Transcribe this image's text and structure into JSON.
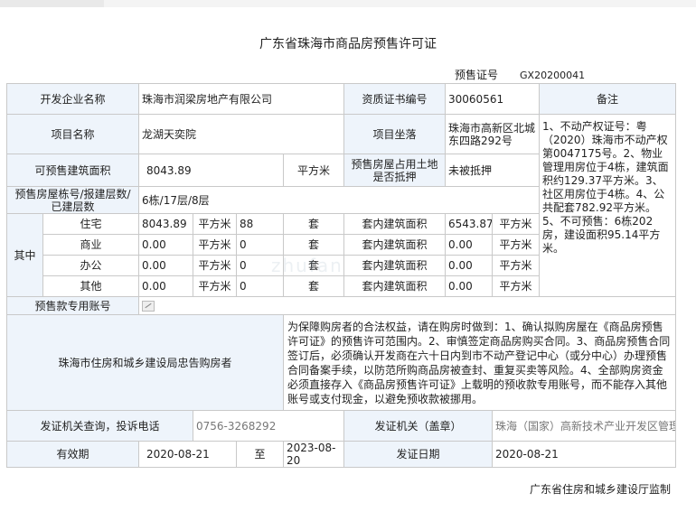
{
  "title": "广东省珠海市商品房预售许可证",
  "permit": {
    "label": "预售证号",
    "value": "GX20200041"
  },
  "labels": {
    "developer": "开发企业名称",
    "qualification": "资质证书编号",
    "remarks": "备注",
    "project_name": "项目名称",
    "project_location": "项目坐落",
    "pre_sale_area": "可预售建筑面积",
    "land_mortgage": "预售房屋占用土地是否抵押",
    "buildings": "预售房屋栋号/报建层数/已建层数",
    "of_which": "其中",
    "inner_area": "套内建筑面积",
    "sqm": "平方米",
    "unit_set": "套",
    "escrow_account": "预售款专用账号",
    "advice": "珠海市住房和城乡建设局忠告购房者",
    "complaint": "发证机关查询，投诉电话",
    "issuer": "发证机关（盖章）",
    "validity": "有效期",
    "to": "至",
    "issue_date_label": "发证日期"
  },
  "values": {
    "developer": "珠海市润梁房地产有限公司",
    "qualification": "30060561",
    "project_name": "龙湖天奕院",
    "project_location": "珠海市高新区北城东四路292号",
    "pre_sale_area": "8043.89",
    "land_mortgage": "未被抵押",
    "buildings": "6栋/17层/8层",
    "remarks": "1、不动产权证号：粤（2020）珠海市不动产权第0047175号。2、物业管理用房位于4栋，建筑面积约129.37平方米。3、社区用房位于4栋。4、公共配套782.92平方米。5、不可预售：6栋202房，建设面积95.14平方米。",
    "advice_text": "为保障购房者的合法权益，请在购房时做到：1、确认拟购房屋在《商品房预售许可证》的预售许可范围内。2、审慎签定商品房购买合同。3、商品房预售合同签订后，必须确认开发商在六十日内到市不动产登记中心（或分中心）办理预售合同备案手续，以防范所购商品房被查封、重复买卖等风险。4、全部购房资金必须直接存入《商品房预售许可证》上载明的预收款专用账号，而不能存入其他账号或支付现金，以避免预收款被挪用。",
    "phone": "0756-3268292",
    "issuer": "珠海（国家）高新技术产业开发区管理委员会",
    "valid_from": "2020-08-21",
    "valid_to": "2023-08-20",
    "issue_date": "2020-08-21"
  },
  "usage_rows": [
    {
      "type": "住宅",
      "area": "8043.89",
      "sets": "88",
      "inner": "6543.87"
    },
    {
      "type": "商业",
      "area": "0.00",
      "sets": "0",
      "inner": "0.00"
    },
    {
      "type": "办公",
      "area": "0.00",
      "sets": "0",
      "inner": "0.00"
    },
    {
      "type": "其他",
      "area": "0.00",
      "sets": "0",
      "inner": "0.00"
    }
  ],
  "footer": "广东省住房和城乡建设厅监制",
  "watermark": "zhufan"
}
